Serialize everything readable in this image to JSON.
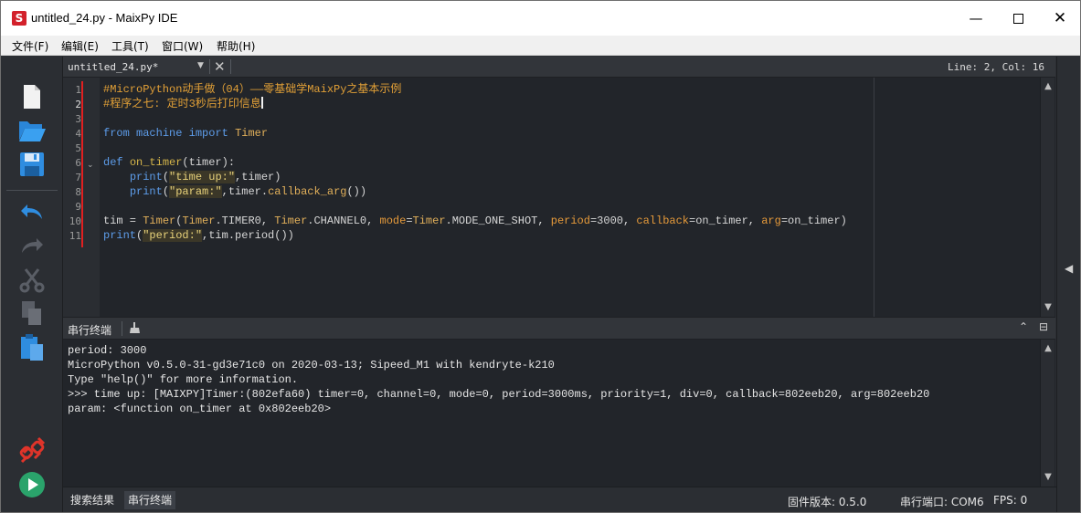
{
  "window": {
    "title": "untitled_24.py - MaixPy IDE",
    "app_icon_letter": "S",
    "minimize_glyph": "—",
    "close_glyph": "✕"
  },
  "menu": {
    "items": [
      "文件(F)",
      "编辑(E)",
      "工具(T)",
      "窗口(W)",
      "帮助(H)"
    ]
  },
  "toolbar": {
    "tools": [
      {
        "name": "new-file-icon",
        "interactable": true
      },
      {
        "name": "open-folder-icon",
        "interactable": true
      },
      {
        "name": "save-icon",
        "interactable": true
      },
      {
        "name": "undo-icon",
        "interactable": true
      },
      {
        "name": "redo-icon",
        "interactable": false
      },
      {
        "name": "cut-icon",
        "interactable": false
      },
      {
        "name": "copy-icon",
        "interactable": false
      },
      {
        "name": "paste-icon",
        "interactable": true
      },
      {
        "name": "disconnect-icon",
        "interactable": true
      },
      {
        "name": "run-icon",
        "interactable": true
      }
    ]
  },
  "editor": {
    "file_tab": "untitled_24.py*",
    "tab_dropdown_glyph": "▼",
    "tab_close_glyph": "✕",
    "cursor_position": "Line: 2, Col: 16",
    "fold_glyph": "⌄",
    "line_numbers": [
      "1",
      "2",
      "3",
      "4",
      "5",
      "6",
      "7",
      "8",
      "9",
      "10",
      "11"
    ],
    "lines": [
      [
        {
          "t": "#MicroPython动手做（04）——零基础学MaixPy之基本示例",
          "c": "cmt"
        }
      ],
      [
        {
          "t": "#程序之七: 定时3秒后打印信息",
          "c": "cmt"
        }
      ],
      [],
      [
        {
          "t": "from",
          "c": "kw"
        },
        {
          "t": " "
        },
        {
          "t": "machine",
          "c": "kw"
        },
        {
          "t": " "
        },
        {
          "t": "import",
          "c": "kw"
        },
        {
          "t": " "
        },
        {
          "t": "Timer",
          "c": "cls"
        }
      ],
      [],
      [
        {
          "t": "def",
          "c": "kw"
        },
        {
          "t": " "
        },
        {
          "t": "on_timer",
          "c": "def"
        },
        {
          "t": "(timer):"
        }
      ],
      [
        {
          "t": "    "
        },
        {
          "t": "print",
          "c": "kw"
        },
        {
          "t": "("
        },
        {
          "t": "\"time up:\"",
          "c": "str"
        },
        {
          "t": ",timer)"
        }
      ],
      [
        {
          "t": "    "
        },
        {
          "t": "print",
          "c": "kw"
        },
        {
          "t": "("
        },
        {
          "t": "\"param:\"",
          "c": "str"
        },
        {
          "t": ",timer."
        },
        {
          "t": "callback_arg",
          "c": "fn"
        },
        {
          "t": "())"
        }
      ],
      [],
      [
        {
          "t": "tim = "
        },
        {
          "t": "Timer",
          "c": "cls"
        },
        {
          "t": "("
        },
        {
          "t": "Timer",
          "c": "cls"
        },
        {
          "t": ".TIMER0, "
        },
        {
          "t": "Timer",
          "c": "cls"
        },
        {
          "t": ".CHANNEL0, "
        },
        {
          "t": "mode",
          "c": "kwarg"
        },
        {
          "t": "="
        },
        {
          "t": "Timer",
          "c": "cls"
        },
        {
          "t": ".MODE_ONE_SHOT, "
        },
        {
          "t": "period",
          "c": "kwarg"
        },
        {
          "t": "=3000, "
        },
        {
          "t": "callback",
          "c": "kwarg"
        },
        {
          "t": "=on_timer, "
        },
        {
          "t": "arg",
          "c": "kwarg"
        },
        {
          "t": "=on_timer)"
        }
      ],
      [
        {
          "t": "print",
          "c": "kw"
        },
        {
          "t": "("
        },
        {
          "t": "\"period:\"",
          "c": "str"
        },
        {
          "t": ",tim.period())"
        }
      ]
    ]
  },
  "scroll": {
    "up_glyph": "▲",
    "down_glyph": "▼"
  },
  "side_panel": {
    "collapse_glyph": "◀"
  },
  "terminal": {
    "title": "串行终端",
    "clear_glyph": "🧹",
    "maximize_glyph": "⌃",
    "restore_glyph": "⊟",
    "lines": [
      "period: 3000",
      "MicroPython v0.5.0-31-gd3e71c0 on 2020-03-13; Sipeed_M1 with kendryte-k210",
      "Type \"help()\" for more information.",
      ">>> time up: [MAIXPY]Timer:(802efa60) timer=0, channel=0, mode=0, period=3000ms, priority=1, div=0, callback=802eeb20, arg=802eeb20",
      "param: <function on_timer at 0x802eeb20>"
    ]
  },
  "statusbar": {
    "tabs": [
      "搜索结果",
      "串行终端"
    ],
    "firmware": "固件版本: 0.5.0",
    "port": "串行端口: COM6",
    "fps": "FPS: 0"
  },
  "colors": {
    "background": "#22252a",
    "comment": "#e2a037",
    "keyword": "#5d9ce9",
    "change_marker": "#e02020",
    "run_button": "#2aa36b",
    "disconnect": "#e0342a"
  }
}
